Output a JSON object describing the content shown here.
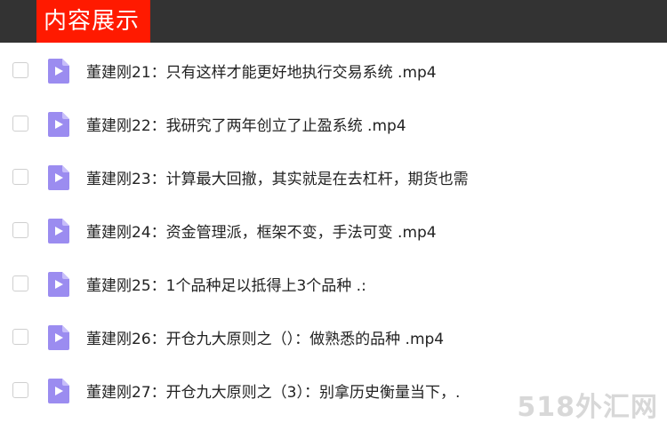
{
  "header": {
    "title": "内容展示"
  },
  "files": [
    {
      "label": "董建刚21：只有这样才能更好地执行交易系统 .mp4"
    },
    {
      "label": "董建刚22：我研究了两年创立了止盈系统 .mp4"
    },
    {
      "label": "董建刚23：计算最大回撤，其实就是在去杠杆，期货也需"
    },
    {
      "label": "董建刚24：资金管理派，框架不变，手法可变 .mp4"
    },
    {
      "label": "董建刚25：1个品种足以抵得上3个品种 .:"
    },
    {
      "label": "董建刚26：开仓九大原则之（）：做熟悉的品种 .mp4"
    },
    {
      "label": "董建刚27：开仓九大原则之（3）：别拿历史衡量当下，."
    }
  ],
  "icon": {
    "name": "video-file-icon",
    "color": "#9b8cf0"
  },
  "watermark": "518外汇网"
}
